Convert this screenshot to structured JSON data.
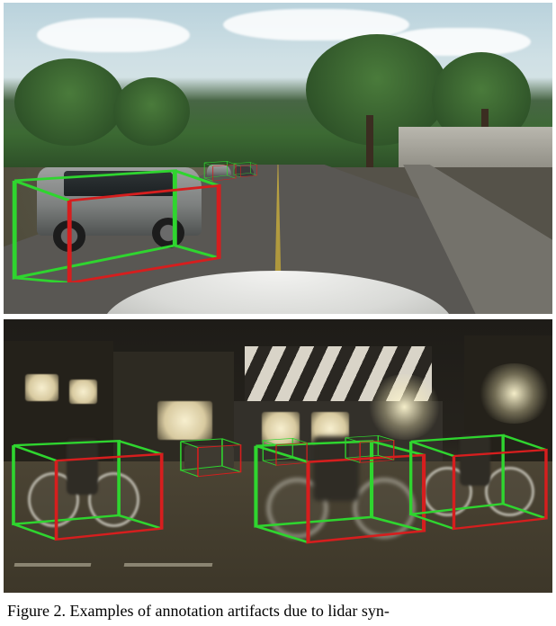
{
  "caption": {
    "label": "Figure 2.",
    "text": "Examples of annotation artifacts due to lidar syn-"
  },
  "boxes": {
    "legend": {
      "front_color": "#d61e1e",
      "back_color": "#2fd52f"
    }
  }
}
